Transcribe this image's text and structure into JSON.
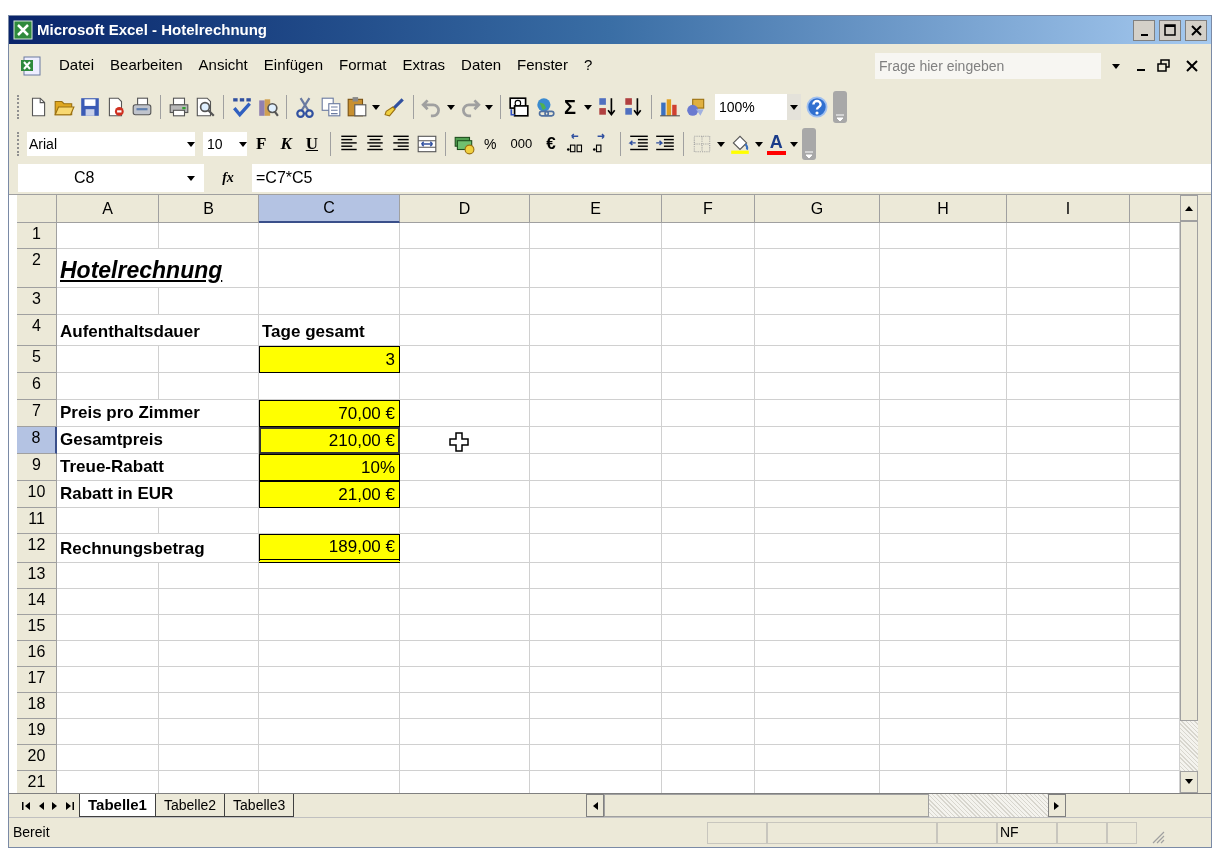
{
  "window": {
    "title": "Microsoft Excel - Hotelrechnung"
  },
  "menu": {
    "items": [
      {
        "label": "Datei"
      },
      {
        "label": "Bearbeiten"
      },
      {
        "label": "Ansicht"
      },
      {
        "label": "Einfügen"
      },
      {
        "label": "Format"
      },
      {
        "label": "Extras"
      },
      {
        "label": "Daten"
      },
      {
        "label": "Fenster"
      },
      {
        "label": "?"
      }
    ],
    "help_box": {
      "placeholder": "Frage hier eingeben"
    }
  },
  "standard_toolbar": {
    "sum_label": "Σ",
    "zoom": "100%"
  },
  "format_toolbar": {
    "font": "Arial",
    "size": "10",
    "bold_label": "F",
    "italic_label": "K",
    "underline_label": "U",
    "percent_label": "%",
    "thousands_label": "000",
    "euro_label": "€",
    "font_color_label": "A"
  },
  "formula_bar": {
    "name_box": "C8",
    "fx_label": "fx",
    "formula": "=C7*C5"
  },
  "sheet": {
    "columns": [
      {
        "label": "A",
        "selected": false
      },
      {
        "label": "B",
        "selected": false
      },
      {
        "label": "C",
        "selected": true
      },
      {
        "label": "D",
        "selected": false
      },
      {
        "label": "E",
        "selected": false
      },
      {
        "label": "F",
        "selected": false
      },
      {
        "label": "G",
        "selected": false
      },
      {
        "label": "H",
        "selected": false
      },
      {
        "label": "I",
        "selected": false
      }
    ],
    "rows": [
      {
        "label": "1",
        "selected": false
      },
      {
        "label": "2",
        "selected": false,
        "cells": {
          "A": {
            "text": "Hotelrechnung",
            "kind": "title",
            "selected": false
          }
        }
      },
      {
        "label": "3",
        "selected": false
      },
      {
        "label": "4",
        "selected": false,
        "cells": {
          "A": {
            "text": "Aufenthaltsdauer",
            "kind": "label",
            "selected": false
          },
          "C": {
            "text": "Tage gesamt",
            "kind": "label",
            "selected": false
          }
        }
      },
      {
        "label": "5",
        "selected": false,
        "cells": {
          "C": {
            "text": "3",
            "kind": "value",
            "selected": false
          }
        }
      },
      {
        "label": "6",
        "selected": false
      },
      {
        "label": "7",
        "selected": false,
        "cells": {
          "A": {
            "text": "Preis pro Zimmer",
            "kind": "label",
            "selected": false
          },
          "C": {
            "text": "70,00 €",
            "kind": "value",
            "selected": false
          }
        }
      },
      {
        "label": "8",
        "selected": true,
        "cells": {
          "A": {
            "text": "Gesamtpreis",
            "kind": "label",
            "selected": false
          },
          "C": {
            "text": "210,00 €",
            "kind": "value",
            "selected": true
          }
        }
      },
      {
        "label": "9",
        "selected": false,
        "cells": {
          "A": {
            "text": "Treue-Rabatt",
            "kind": "label",
            "selected": false
          },
          "C": {
            "text": "10%",
            "kind": "value",
            "selected": false
          }
        }
      },
      {
        "label": "10",
        "selected": false,
        "cells": {
          "A": {
            "text": "Rabatt in EUR",
            "kind": "label",
            "selected": false
          },
          "C": {
            "text": "21,00 €",
            "kind": "value",
            "selected": false
          }
        }
      },
      {
        "label": "11",
        "selected": false
      },
      {
        "label": "12",
        "selected": false,
        "cells": {
          "A": {
            "text": "Rechnungsbetrag",
            "kind": "label",
            "selected": false
          },
          "C": {
            "text": "189,00 €",
            "kind": "total",
            "selected": false
          }
        }
      },
      {
        "label": "13",
        "selected": false
      },
      {
        "label": "14",
        "selected": false
      },
      {
        "label": "15",
        "selected": false
      },
      {
        "label": "16",
        "selected": false
      },
      {
        "label": "17",
        "selected": false
      },
      {
        "label": "18",
        "selected": false
      },
      {
        "label": "19",
        "selected": false
      },
      {
        "label": "20",
        "selected": false
      },
      {
        "label": "21",
        "selected": false
      }
    ]
  },
  "sheet_tabs": [
    {
      "label": "Tabelle1",
      "selected": true
    },
    {
      "label": "Tabelle2",
      "selected": false
    },
    {
      "label": "Tabelle3",
      "selected": false
    }
  ],
  "status_bar": {
    "status": "Bereit",
    "indicator": "NF"
  }
}
